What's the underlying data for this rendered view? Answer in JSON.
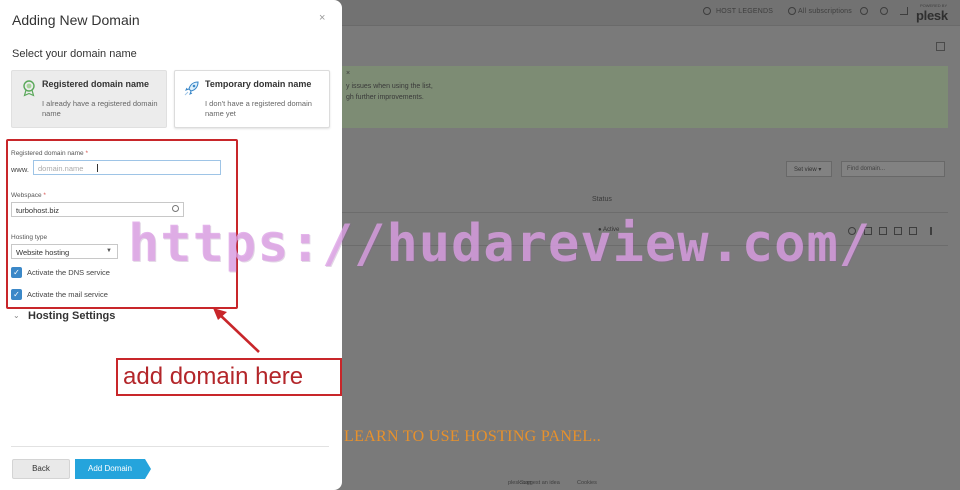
{
  "background": {
    "topbar": {
      "host_legends": "HOST LEGENDS",
      "all_subscriptions": "All subscriptions",
      "logo_small": "POWERED BY",
      "logo": "plesk"
    },
    "notice": {
      "line1": "y issues when using the list,",
      "line2": "gh further improvements."
    },
    "set_view": "Set view",
    "find_placeholder": "Find domain...",
    "status_header": "Status",
    "active_status": "Active",
    "footer": {
      "link1": "plesk.com",
      "link2": "Suggest an idea",
      "link3": "Cookies"
    }
  },
  "modal": {
    "title": "Adding New Domain",
    "close": "×",
    "section_title": "Select your domain name",
    "options": [
      {
        "title": "Registered domain name",
        "desc": "I already have a registered domain name",
        "selected": true
      },
      {
        "title": "Temporary domain name",
        "desc": "I don't have a registered domain name yet",
        "selected": false
      }
    ],
    "form": {
      "domain_label": "Registered domain name",
      "required_mark": "*",
      "www_prefix": "www.",
      "domain_placeholder": "domain.name",
      "webspace_label": "Webspace",
      "webspace_value": "turbohost.biz",
      "hosting_type_label": "Hosting type",
      "hosting_type_value": "Website hosting",
      "dns_label": "Activate the DNS service",
      "mail_label": "Activate the mail service"
    },
    "hosting_settings": "Hosting Settings",
    "back_button": "Back",
    "add_button": "Add Domain"
  },
  "overlay": {
    "callout": "add domain here",
    "watermark": "https://hudareview.com/",
    "caption": "LEARN TO USE HOSTING PANEL.."
  },
  "colors": {
    "accent": "#25a4dc",
    "checkbox": "#3b88c8",
    "annotation_red": "#c8262a",
    "watermark": "#dca0e6",
    "caption": "#e8912b"
  }
}
